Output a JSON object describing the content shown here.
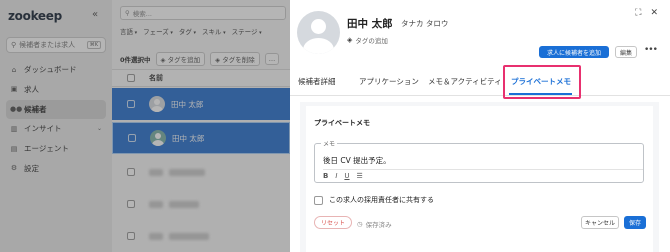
{
  "sidebar": {
    "logo": "zookeep",
    "collapse_icon": "«",
    "search_placeholder": "候補者または求人",
    "search_shortcut": "⌘K",
    "items": [
      {
        "label": "ダッシュボード",
        "icon": "house-icon"
      },
      {
        "label": "求人",
        "icon": "briefcase-icon"
      },
      {
        "label": "候補者",
        "icon": "people-icon",
        "active": true
      },
      {
        "label": "インサイト",
        "icon": "chart-icon",
        "expandable": true
      },
      {
        "label": "エージェント",
        "icon": "building-icon"
      },
      {
        "label": "設定",
        "icon": "gear-icon"
      }
    ]
  },
  "main": {
    "search_placeholder": "検索...",
    "filters": [
      "言語",
      "フェーズ",
      "タグ",
      "スキル",
      "ステージ"
    ],
    "selected_count": "0件選択中",
    "add_tag": "タグを追加",
    "remove_tag": "タグを削除",
    "more": "…",
    "column_name": "名前",
    "rows": [
      {
        "name": "田中 太郎"
      },
      {
        "name": "田中 太郎"
      }
    ]
  },
  "panel": {
    "name": "田中 太郎",
    "kana": "タナカ タロウ",
    "add_tag": "タグの追加",
    "add_to_job": "求人に候補者を追加",
    "edit": "編集",
    "more": "•••",
    "tabs": [
      "候補者詳細",
      "アプリケーション",
      "メモ＆アクティビティ",
      "プライベートメモ"
    ],
    "active_tab_index": 3,
    "memo_section_title": "プライベートメモ",
    "memo_label": "メモ",
    "memo_text": "後日 CV 提出予定。",
    "format": {
      "bold": "B",
      "italic": "I",
      "underline": "U",
      "list": "☰"
    },
    "share_label": "この求人の採用責任者に共有する",
    "reset": "リセット",
    "saved": "保存済み",
    "cancel": "キャンセル",
    "save": "保存",
    "colors": {
      "primary": "#1a6fd6",
      "highlight": "#e8306f",
      "selected_row": "#2e74d0"
    }
  }
}
